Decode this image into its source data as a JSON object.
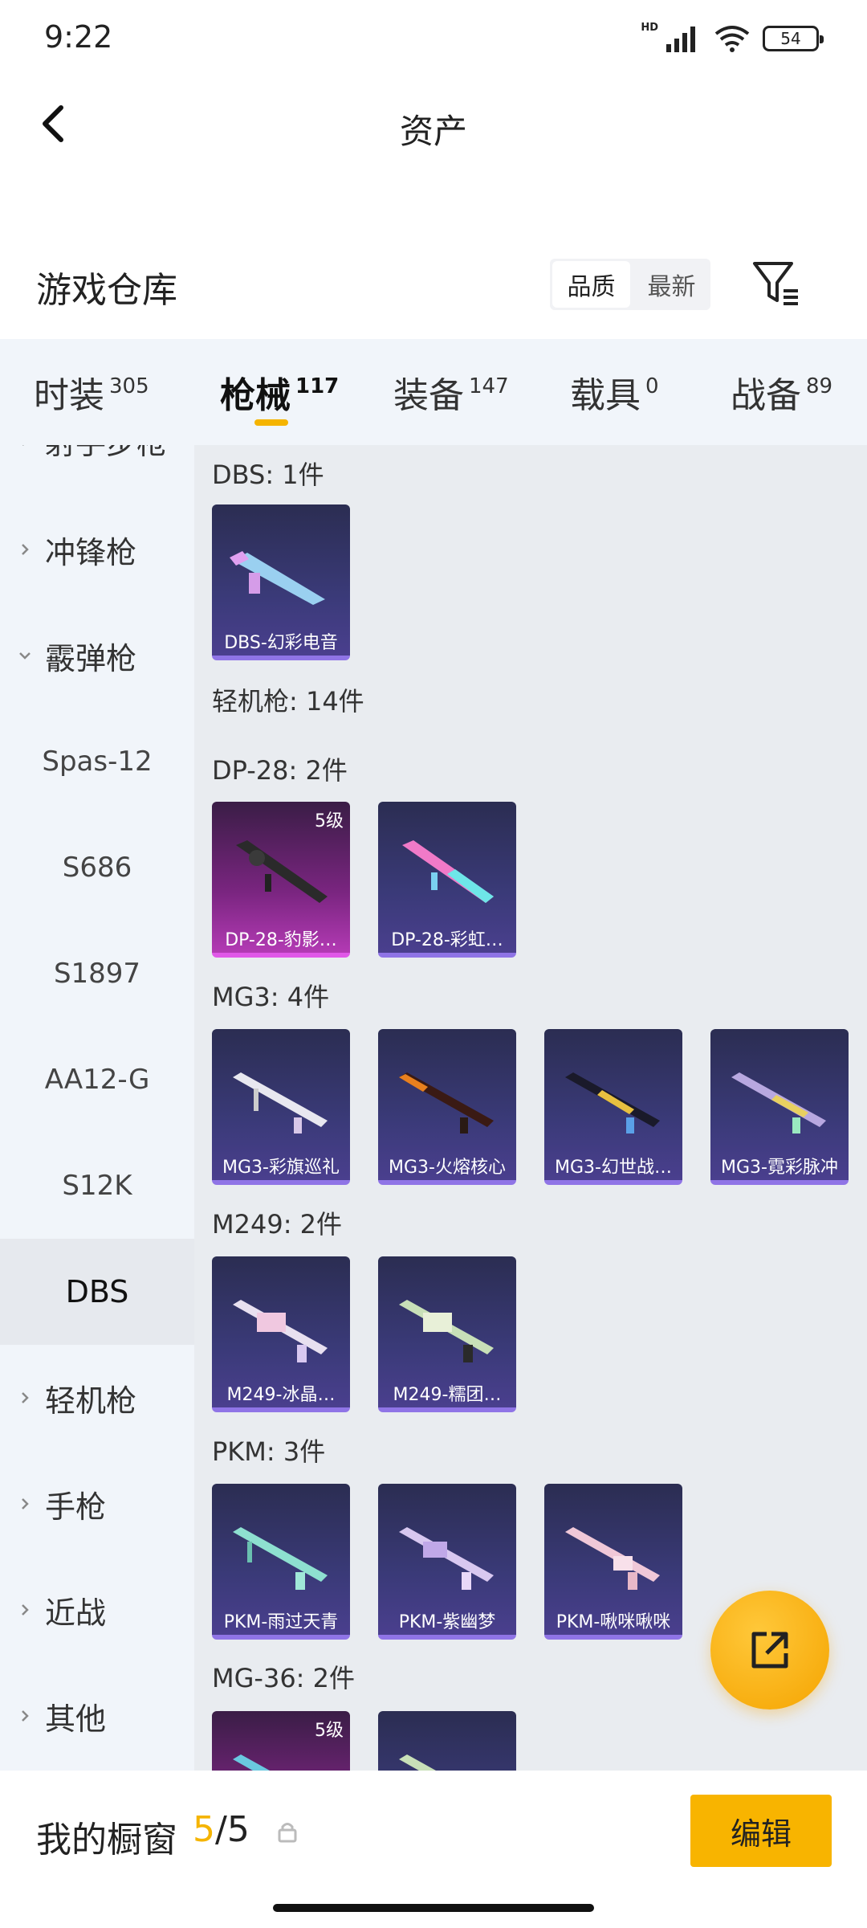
{
  "status": {
    "time": "9:22",
    "network": "HD",
    "battery": "54"
  },
  "header": {
    "title": "资产"
  },
  "warehouse": {
    "title": "游戏仓库",
    "sort": {
      "quality": "品质",
      "newest": "最新",
      "active": "品质"
    }
  },
  "tabs": [
    {
      "label": "时装",
      "count": "305"
    },
    {
      "label": "枪械",
      "count": "117"
    },
    {
      "label": "装备",
      "count": "147"
    },
    {
      "label": "载具",
      "count": "0"
    },
    {
      "label": "战备",
      "count": "89"
    }
  ],
  "sidebar": {
    "partial": "射手步枪",
    "smg": "冲锋枪",
    "shotgun": "霰弹枪",
    "shotgun_items": [
      "Spas-12",
      "S686",
      "S1897",
      "AA12-G",
      "S12K",
      "DBS"
    ],
    "lmg": "轻机枪",
    "pistol": "手枪",
    "melee": "近战",
    "other": "其他"
  },
  "content": {
    "dbs_header": "DBS: 1件",
    "lmg_header": "轻机枪: 14件",
    "dp28_header": "DP-28: 2件",
    "mg3_header": "MG3: 4件",
    "m249_header": "M249: 2件",
    "pkm_header": "PKM: 3件",
    "mg36_header": "MG-36: 2件",
    "cards": {
      "dbs1": "DBS-幻彩电音",
      "dp1": "DP-28-豹影…",
      "dp1_level": "5级",
      "dp2": "DP-28-彩虹…",
      "mg1": "MG3-彩旗巡礼",
      "mg2": "MG3-火熔核心",
      "mg3": "MG3-幻世战…",
      "mg4": "MG3-霓彩脉冲",
      "m1": "M249-冰晶…",
      "m2": "M249-糯团…",
      "p1": "PKM-雨过天青",
      "p2": "PKM-紫幽梦",
      "p3": "PKM-啾咪啾咪",
      "mg36_level": "5级"
    }
  },
  "bottom": {
    "window_label": "我的橱窗",
    "count_current": "5",
    "count_sep": "/",
    "count_total": "5",
    "edit": "编辑"
  }
}
